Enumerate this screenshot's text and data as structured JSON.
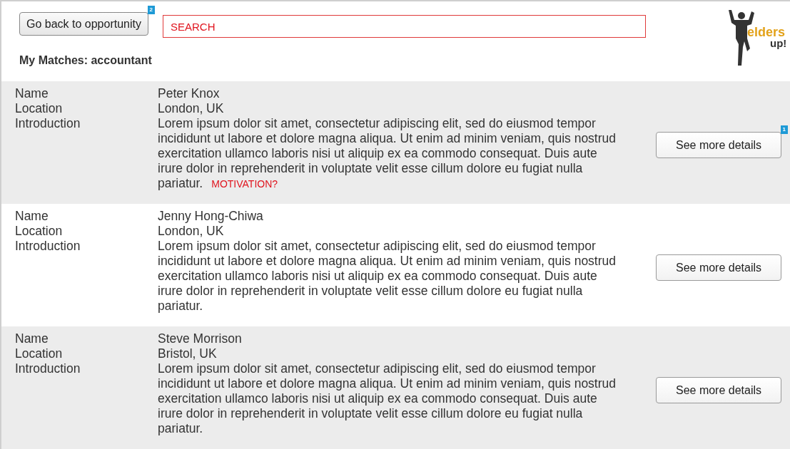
{
  "header": {
    "back_button": {
      "label": "Go back to opportunity",
      "badge": "2"
    },
    "search": {
      "placeholder": "SEARCH"
    },
    "title": "My Matches: accountant",
    "logo": {
      "word1": "elders",
      "word2": "up!"
    }
  },
  "matches": [
    {
      "labels": [
        "Name",
        "Location",
        "Introduction"
      ],
      "name": "Peter Knox",
      "location": "London, UK",
      "introduction": "Lorem ipsum dolor sit amet, consectetur adipiscing elit, sed do eiusmod tempor incididunt ut labore et dolore magna aliqua. Ut enim ad minim veniam, quis nostrud exercitation ullamco laboris nisi ut aliquip ex ea commodo consequat. Duis aute irure dolor in reprehenderit in voluptate velit esse cillum dolore eu fugiat nulla pariatur.",
      "note": "MOTIVATION?",
      "button": "See more details",
      "badge": "1"
    },
    {
      "labels": [
        "Name",
        "Location",
        "Introduction"
      ],
      "name": "Jenny Hong-Chiwa",
      "location": "London, UK",
      "introduction": "Lorem ipsum dolor sit amet, consectetur adipiscing elit, sed do eiusmod tempor incididunt ut labore et dolore magna aliqua. Ut enim ad minim veniam, quis nostrud exercitation ullamco laboris nisi ut aliquip ex ea commodo consequat. Duis aute irure dolor in reprehenderit in voluptate velit esse cillum dolore eu fugiat nulla pariatur.",
      "button": "See more details"
    },
    {
      "labels": [
        "Name",
        "Location",
        "Introduction"
      ],
      "name": "Steve Morrison",
      "location": "Bristol, UK",
      "introduction": "Lorem ipsum dolor sit amet, consectetur adipiscing elit, sed do eiusmod tempor incididunt ut labore et dolore magna aliqua. Ut enim ad minim veniam, quis nostrud exercitation ullamco laboris nisi ut aliquip ex ea commodo consequat. Duis aute irure dolor in reprehenderit in voluptate velit esse cillum dolore eu fugiat nulla pariatur.",
      "button": "See more details"
    }
  ]
}
